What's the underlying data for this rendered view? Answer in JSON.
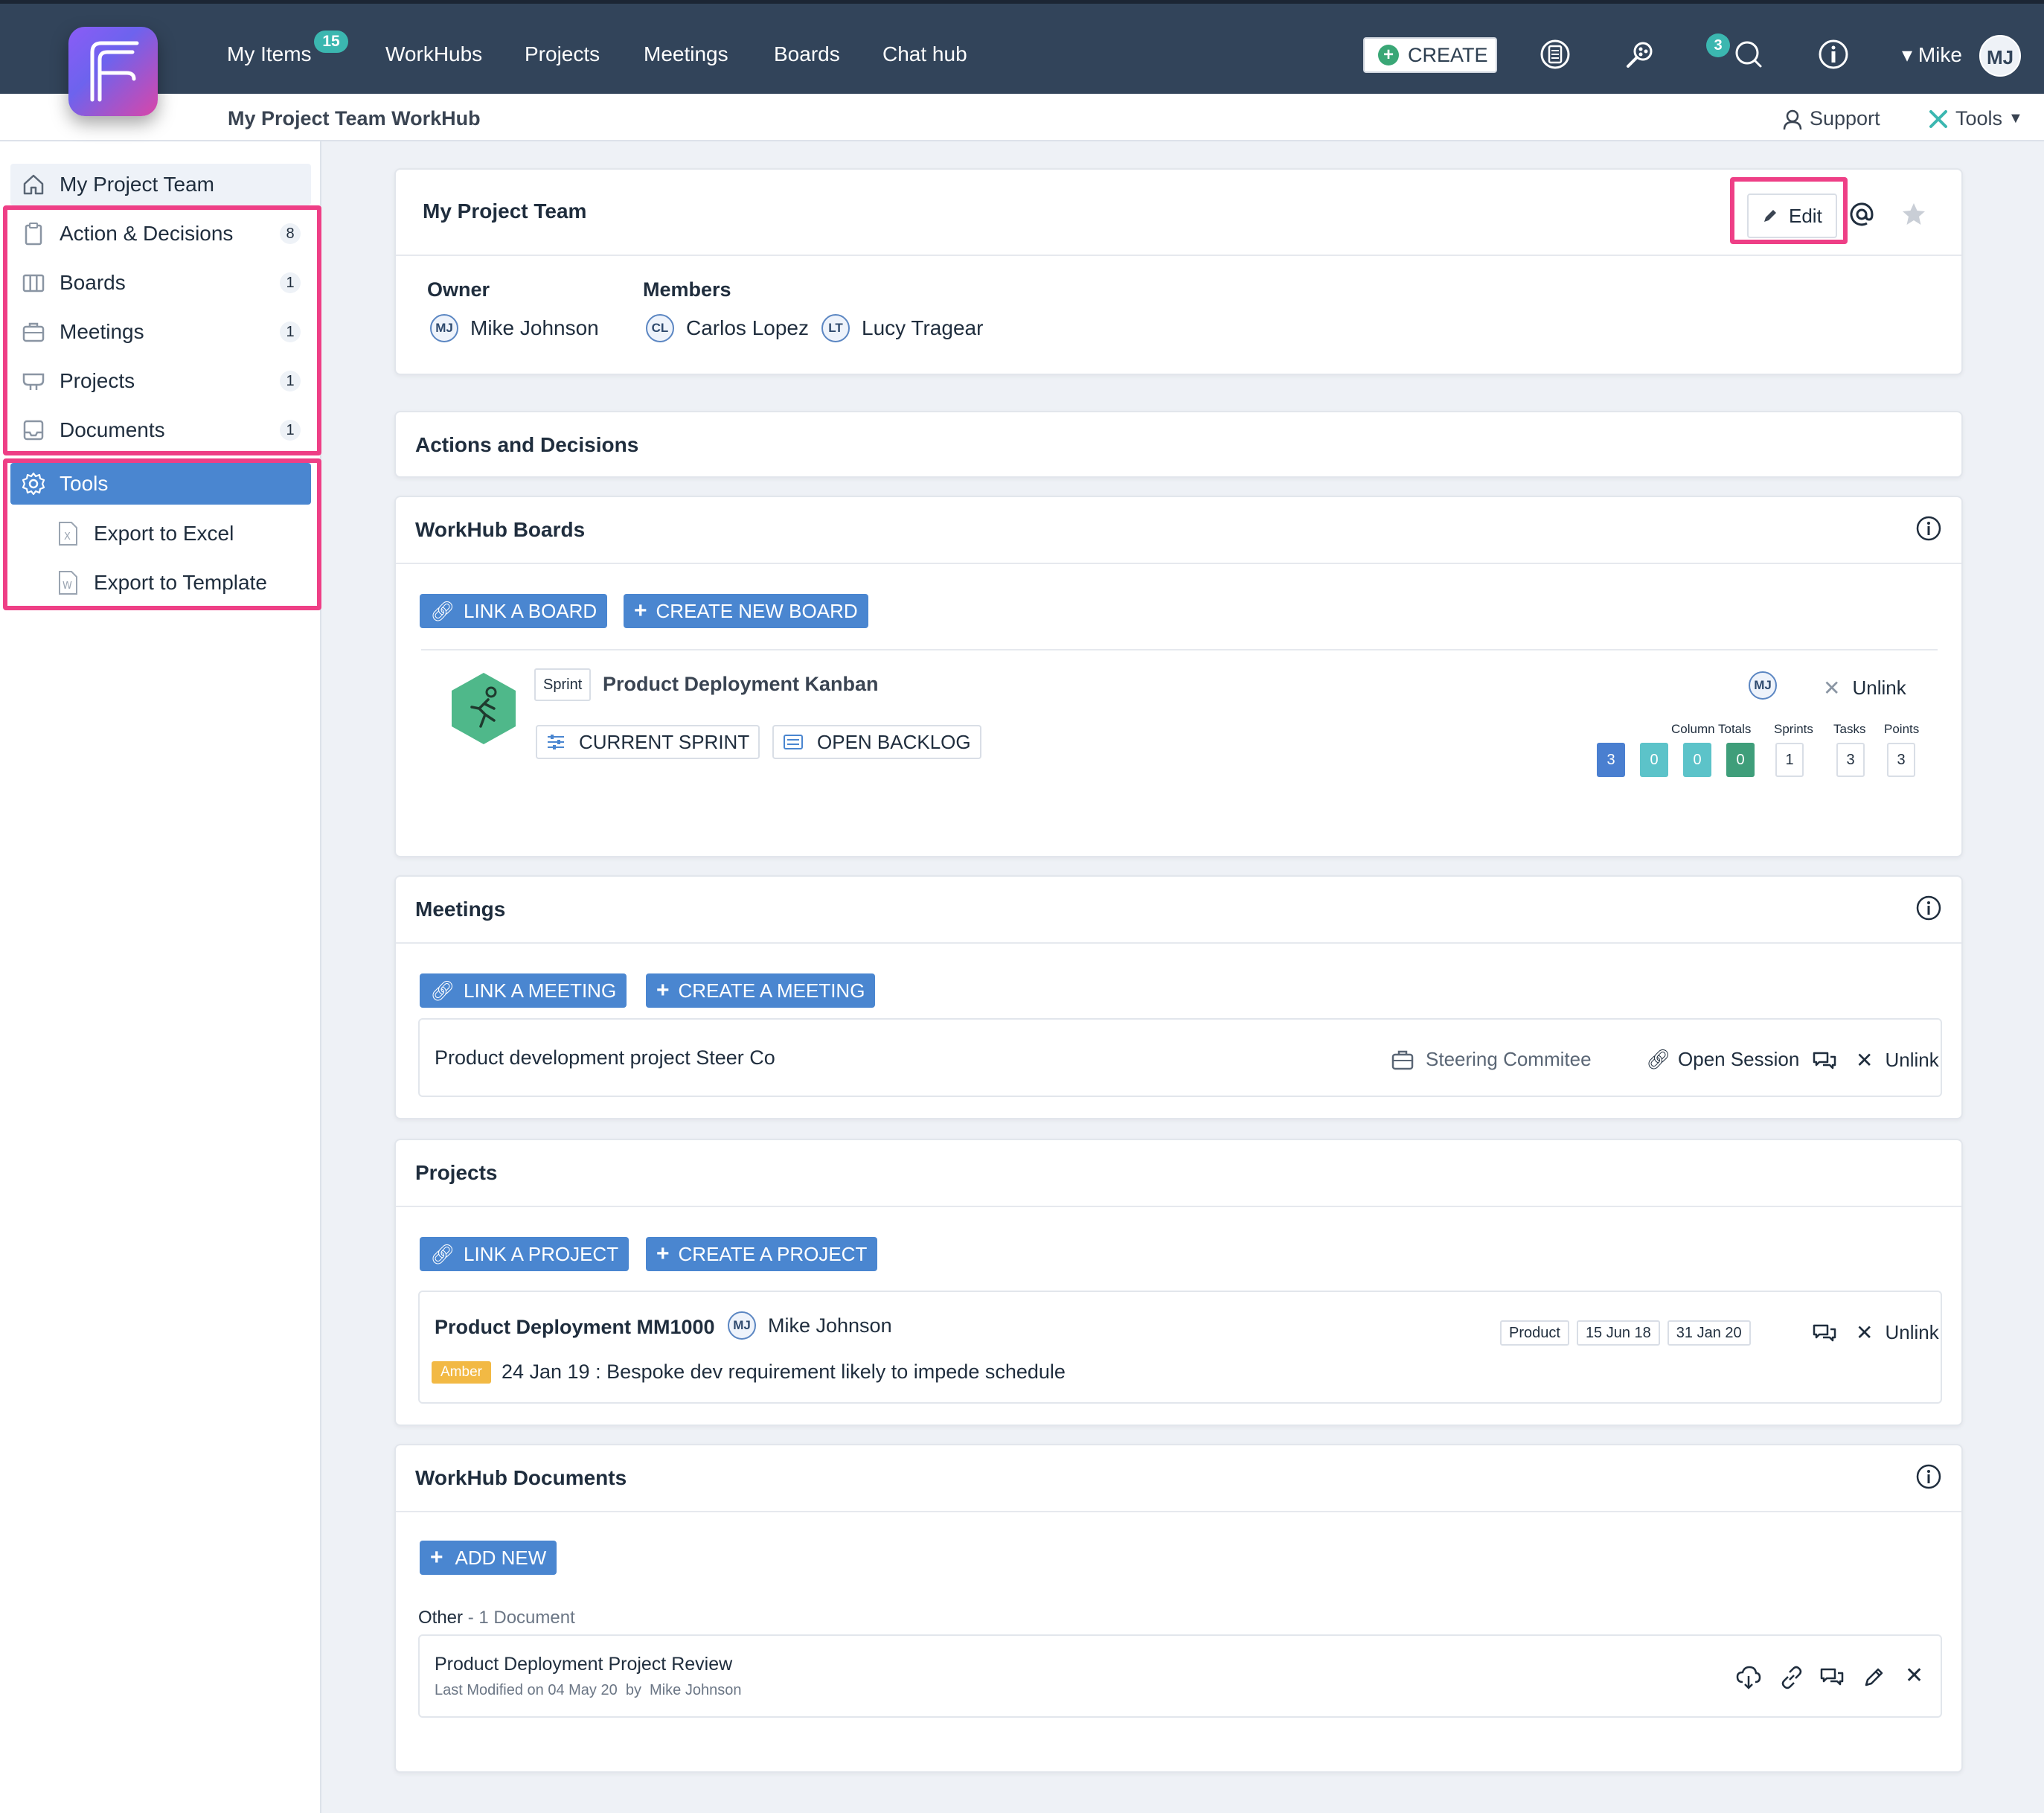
{
  "topnav": {
    "items": [
      "My Items",
      "WorkHubs",
      "Projects",
      "Meetings",
      "Boards",
      "Chat hub"
    ],
    "my_items_badge": "15",
    "create_label": "CREATE",
    "chat_badge": "3",
    "user_name": "Mike",
    "user_initials": "MJ"
  },
  "subheader": {
    "title": "My Project Team WorkHub",
    "support": "Support",
    "tools": "Tools"
  },
  "sidebar": {
    "home": "My Project Team",
    "items": [
      {
        "label": "Action & Decisions",
        "count": "8",
        "icon": "clipboard-icon"
      },
      {
        "label": "Boards",
        "count": "1",
        "icon": "columns-icon"
      },
      {
        "label": "Meetings",
        "count": "1",
        "icon": "briefcase-icon"
      },
      {
        "label": "Projects",
        "count": "1",
        "icon": "tray-icon"
      },
      {
        "label": "Documents",
        "count": "1",
        "icon": "inbox-icon"
      }
    ],
    "tools": "Tools",
    "tool_items": [
      "Export to Excel",
      "Export to Template"
    ]
  },
  "team": {
    "title": "My Project Team",
    "edit": "Edit",
    "owner_label": "Owner",
    "members_label": "Members",
    "owner": {
      "initials": "MJ",
      "name": "Mike Johnson"
    },
    "members": [
      {
        "initials": "CL",
        "name": "Carlos Lopez"
      },
      {
        "initials": "LT",
        "name": "Lucy Tragear"
      }
    ]
  },
  "actions": {
    "title": "Actions and Decisions"
  },
  "boards": {
    "title": "WorkHub Boards",
    "link_btn": "LINK A BOARD",
    "create_btn": "CREATE NEW BOARD",
    "board": {
      "tag": "Sprint",
      "name": "Product Deployment Kanban",
      "owner_initials": "MJ",
      "unlink": "Unlink",
      "current_sprint": "CURRENT SPRINT",
      "open_backlog": "OPEN BACKLOG",
      "stats_labels": {
        "column_totals": "Column Totals",
        "sprints": "Sprints",
        "tasks": "Tasks",
        "points": "Points"
      },
      "column_totals": [
        "3",
        "0",
        "0",
        "0"
      ],
      "sprints": "1",
      "tasks": "3",
      "points": "3"
    }
  },
  "meetings": {
    "title": "Meetings",
    "link_btn": "LINK A MEETING",
    "create_btn": "CREATE A MEETING",
    "meeting": {
      "name": "Product development project Steer Co",
      "type": "Steering Commitee",
      "open_session": "Open Session",
      "unlink": "Unlink"
    }
  },
  "projects": {
    "title": "Projects",
    "link_btn": "LINK A PROJECT",
    "create_btn": "CREATE A PROJECT",
    "project": {
      "name": "Product Deployment MM1000",
      "owner_initials": "MJ",
      "owner": "Mike Johnson",
      "tag": "Product",
      "start": "15 Jun 18",
      "end": "31 Jan 20",
      "unlink": "Unlink",
      "status": "Amber",
      "status_note": "24 Jan 19 : Bespoke dev requirement likely to impede schedule"
    }
  },
  "documents": {
    "title": "WorkHub Documents",
    "add_btn": "ADD NEW",
    "group_label": "Other",
    "group_count": "- 1 Document",
    "doc": {
      "name": "Product Deployment Project Review",
      "meta": "Last Modified on 04 May 20  by  Mike Johnson"
    }
  },
  "colors": {
    "topbar": "#32445a",
    "accent_blue": "#4a86d0",
    "teal": "#3bb7b0",
    "highlight": "#ee3f86",
    "stat_blue": "#4a7fd0",
    "stat_teal": "#5cc3c9",
    "stat_green": "#3f9e7a",
    "amber": "#f2b944"
  }
}
